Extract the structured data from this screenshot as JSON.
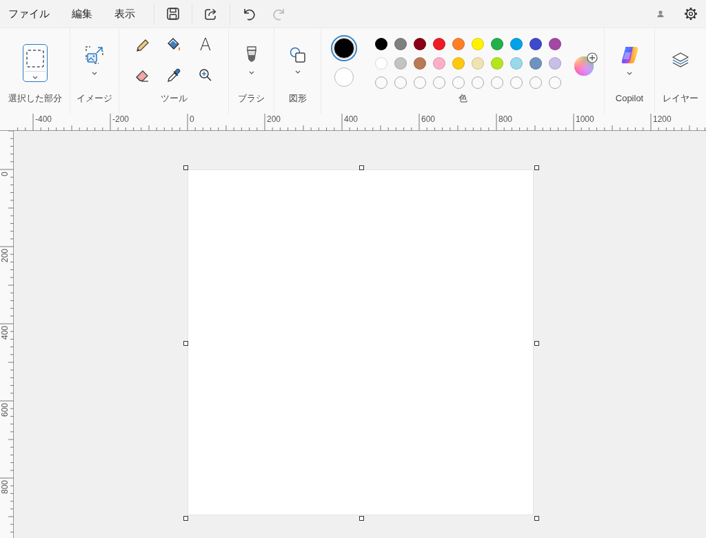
{
  "menu": [
    "ファイル",
    "編集",
    "表示"
  ],
  "quick_access": [
    {
      "kind": "save",
      "disabled": false
    },
    {
      "kind": "share",
      "disabled": false
    },
    {
      "kind": "undo",
      "disabled": false
    },
    {
      "kind": "redo",
      "disabled": true
    }
  ],
  "ribbon": {
    "selection": {
      "label": "選択した部分",
      "selected": true
    },
    "image": {
      "label": "イメージ"
    },
    "tools": {
      "label": "ツール",
      "items": [
        {
          "kind": "pencil",
          "selected": false
        },
        {
          "kind": "fill",
          "selected": false
        },
        {
          "kind": "text",
          "glyph": "A",
          "selected": false
        },
        {
          "kind": "eraser",
          "selected": false
        },
        {
          "kind": "picker",
          "selected": false
        },
        {
          "kind": "magnifier",
          "selected": false
        }
      ]
    },
    "brushes": {
      "label": "ブラシ"
    },
    "shapes": {
      "label": "図形"
    },
    "colors": {
      "label": "色",
      "primary": {
        "color": "#000000",
        "selected": true
      },
      "secondary": {
        "color": "#ffffff",
        "selected": false
      },
      "palette": [
        {
          "kind": "swatch",
          "color": "#000000"
        },
        {
          "kind": "swatch",
          "color": "#7f7f7f"
        },
        {
          "kind": "swatch",
          "color": "#880015"
        },
        {
          "kind": "swatch",
          "color": "#ed1c24"
        },
        {
          "kind": "swatch",
          "color": "#ff7f27"
        },
        {
          "kind": "swatch",
          "color": "#fff200"
        },
        {
          "kind": "swatch",
          "color": "#22b14c"
        },
        {
          "kind": "swatch",
          "color": "#00a2e8"
        },
        {
          "kind": "swatch",
          "color": "#3f48cc"
        },
        {
          "kind": "swatch",
          "color": "#a349a4"
        },
        {
          "kind": "swatch",
          "color": "#ffffff"
        },
        {
          "kind": "swatch",
          "color": "#c3c3c3"
        },
        {
          "kind": "swatch",
          "color": "#b97a57"
        },
        {
          "kind": "swatch",
          "color": "#ffaec9"
        },
        {
          "kind": "swatch",
          "color": "#ffc90e"
        },
        {
          "kind": "swatch",
          "color": "#efe4b0"
        },
        {
          "kind": "swatch",
          "color": "#b5e61d"
        },
        {
          "kind": "swatch",
          "color": "#99d9ea"
        },
        {
          "kind": "swatch",
          "color": "#7092be"
        },
        {
          "kind": "swatch",
          "color": "#c8bfe7"
        },
        {
          "kind": "empty"
        },
        {
          "kind": "empty"
        },
        {
          "kind": "empty"
        },
        {
          "kind": "empty"
        },
        {
          "kind": "empty"
        },
        {
          "kind": "empty"
        },
        {
          "kind": "empty"
        },
        {
          "kind": "empty"
        },
        {
          "kind": "empty"
        },
        {
          "kind": "empty"
        }
      ]
    },
    "copilot": {
      "label": "Copilot"
    },
    "layers": {
      "label": "レイヤー"
    }
  },
  "ruler_top": {
    "labels": [
      "-400",
      "-200",
      "0",
      "200",
      "400",
      "600",
      "800",
      "1000",
      "1200"
    ]
  },
  "ruler_left": {
    "labels": [
      "0",
      "200",
      "400",
      "600",
      "800"
    ]
  }
}
